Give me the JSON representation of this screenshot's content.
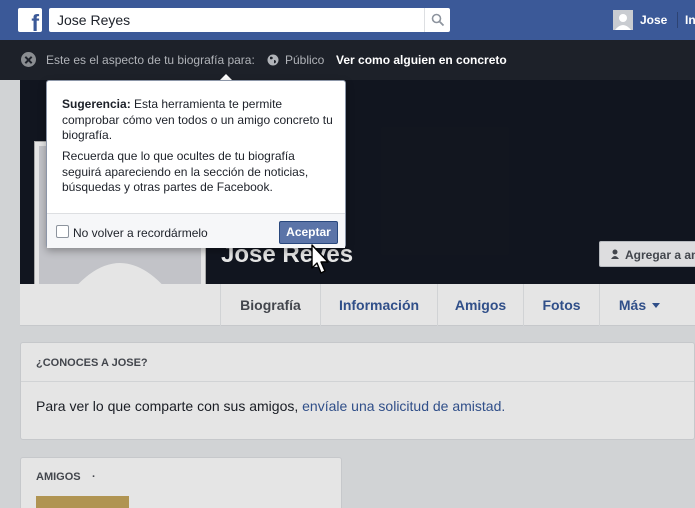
{
  "topbar": {
    "logo": "f",
    "search_value": "Jose Reyes",
    "user_name": "Jose",
    "home_label": "In"
  },
  "viewbar": {
    "text": "Este es el aspecto de tu biografía para:",
    "audience": "Público",
    "view_as_link": "Ver como alguien en concreto"
  },
  "cover": {
    "name": "Jose Reyes",
    "add_friend_label": "Agregar a ami"
  },
  "tabs": [
    {
      "label": "Biografía"
    },
    {
      "label": "Información"
    },
    {
      "label": "Amigos"
    },
    {
      "label": "Fotos"
    },
    {
      "label": "Más"
    }
  ],
  "know_box": {
    "heading": "¿CONOCES A JOSE?",
    "text": "Para ver lo que comparte con sus amigos, ",
    "link": "envíale una solicitud de amistad."
  },
  "friends_box": {
    "heading": "AMIGOS",
    "dot": "·"
  },
  "tooltip": {
    "bold_label": "Sugerencia:",
    "p1": " Esta herramienta te permite comprobar cómo ven todos o un amigo concreto tu biografía.",
    "p2": "Recuerda que lo que ocultes de tu biografía seguirá apareciendo en la sección de noticias, búsquedas y otras partes de Facebook.",
    "checkbox_label": "No volver a recordármelo",
    "accept_label": "Aceptar"
  },
  "colors": {
    "brand_blue": "#3b5998",
    "link_blue": "#365899",
    "dark_bar": "#1d2129",
    "button_blue": "#5b74a8"
  },
  "icons": [
    "facebook-logo-icon",
    "search-icon",
    "close-icon",
    "globe-icon",
    "add-friend-icon",
    "caret-down-icon",
    "pointer-cursor-icon"
  ]
}
